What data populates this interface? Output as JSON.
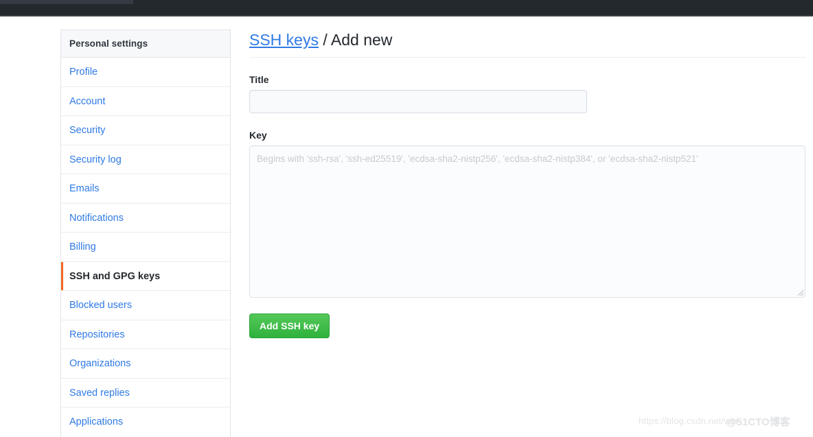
{
  "topbar": {
    "label": "github-dark-header"
  },
  "sidebar": {
    "header": "Personal settings",
    "items": [
      {
        "label": "Profile",
        "selected": false
      },
      {
        "label": "Account",
        "selected": false
      },
      {
        "label": "Security",
        "selected": false
      },
      {
        "label": "Security log",
        "selected": false
      },
      {
        "label": "Emails",
        "selected": false
      },
      {
        "label": "Notifications",
        "selected": false
      },
      {
        "label": "Billing",
        "selected": false
      },
      {
        "label": "SSH and GPG keys",
        "selected": true
      },
      {
        "label": "Blocked users",
        "selected": false
      },
      {
        "label": "Repositories",
        "selected": false
      },
      {
        "label": "Organizations",
        "selected": false
      },
      {
        "label": "Saved replies",
        "selected": false
      },
      {
        "label": "Applications",
        "selected": false
      }
    ],
    "accent_selected": "#f06723",
    "link_color": "#2f7ae5"
  },
  "heading": {
    "link_text": "SSH keys",
    "rest_text": " / Add new"
  },
  "form": {
    "title_label": "Title",
    "title_value": "",
    "title_placeholder": "",
    "key_label": "Key",
    "key_value": "",
    "key_placeholder": "Begins with 'ssh-rsa', 'ssh-ed25519', 'ecdsa-sha2-nistp256', 'ecdsa-sha2-nistp384', or 'ecdsa-sha2-nistp521'",
    "submit_label": "Add SSH key",
    "submit_color": "#2fb13c"
  },
  "watermarks": {
    "url": "https://blog.csdn.net/wei",
    "brand": "@51CTO博客"
  }
}
